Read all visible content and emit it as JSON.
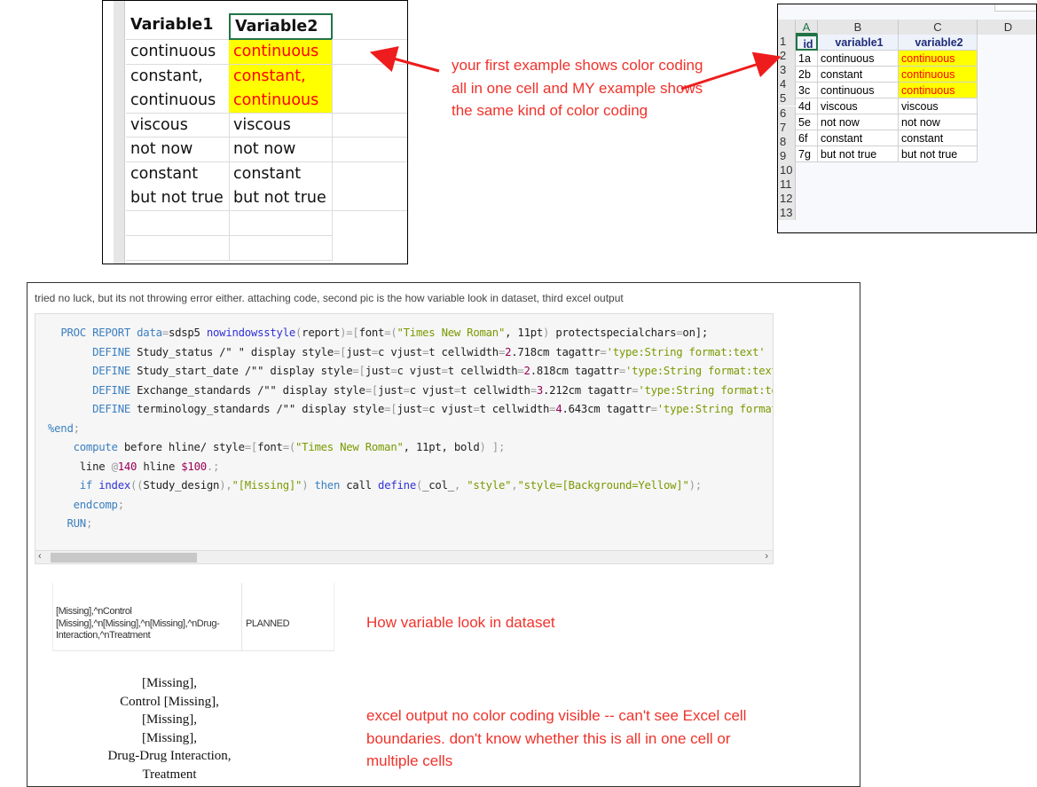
{
  "excel_example_1": {
    "headers": [
      "Variable1",
      "Variable2"
    ],
    "rows": [
      {
        "v1": [
          "continuous"
        ],
        "v2": [
          "continuous"
        ],
        "highlight": true
      },
      {
        "v1": [
          "constant,",
          "continuous"
        ],
        "v2": [
          "constant,",
          "continuous"
        ],
        "highlight": true
      },
      {
        "v1": [
          "viscous"
        ],
        "v2": [
          "viscous"
        ],
        "highlight": false
      },
      {
        "v1": [
          "not now"
        ],
        "v2": [
          "not now"
        ],
        "highlight": false
      },
      {
        "v1": [
          "constant",
          "but not true"
        ],
        "v2": [
          "constant",
          "but not true"
        ],
        "highlight": false
      }
    ]
  },
  "excel_example_2": {
    "col_headers": [
      "A",
      "B",
      "C",
      "D"
    ],
    "row_numbers": [
      "1",
      "2",
      "3",
      "4",
      "5",
      "6",
      "7",
      "8",
      "9",
      "10",
      "11",
      "12",
      "13"
    ],
    "headers": [
      "id",
      "variable1",
      "variable2"
    ],
    "rows": [
      [
        "1a",
        "continuous",
        "continuous"
      ],
      [
        "2b",
        "constant",
        "continuous"
      ],
      [
        "3c",
        "continuous",
        "continuous"
      ],
      [
        "4d",
        "viscous",
        "viscous"
      ],
      [
        "5e",
        "not now",
        "not now"
      ],
      [
        "6f",
        "constant",
        "constant"
      ],
      [
        "7g",
        "but not true",
        "but not true"
      ]
    ],
    "highlighted_rows": [
      0,
      1,
      2
    ]
  },
  "annotations": {
    "first": "your first example shows color coding all in one cell and MY example shows the same kind of color coding",
    "dataset": "How variable look in dataset",
    "excel": "excel output no color coding visible -- can't see Excel cell boundaries. don't know whether this is all in one cell or multiple cells"
  },
  "post": {
    "intro": "tried no luck, but its not throwing error either. attaching code, second pic is the how variable look in dataset, third excel output",
    "code_lines": [
      {
        "indent": "  ",
        "tokens": [
          [
            "PROC REPORT",
            "kw"
          ],
          [
            " ",
            "plain"
          ],
          [
            "data",
            "kw"
          ],
          [
            "=",
            "op"
          ],
          [
            "sdsp5 ",
            "plain"
          ],
          [
            "nowindowsstyle",
            "fn"
          ],
          [
            "(",
            "op"
          ],
          [
            "report",
            "plain"
          ],
          [
            ")=[",
            "op"
          ],
          [
            "font",
            "plain"
          ],
          [
            "=(",
            "op"
          ],
          [
            "\"Times New Roman\"",
            "str"
          ],
          [
            ", 11pt",
            "plain"
          ],
          [
            ")",
            "op"
          ],
          [
            " protectspecialchars",
            "plain"
          ],
          [
            "=",
            "op"
          ],
          [
            "on];",
            "plain"
          ]
        ]
      },
      {
        "indent": "       ",
        "tokens": [
          [
            "DEFINE",
            "kw"
          ],
          [
            " Study_status /\" \" display style",
            "plain"
          ],
          [
            "=[",
            "op"
          ],
          [
            "just",
            "plain"
          ],
          [
            "=",
            "op"
          ],
          [
            "c vjust",
            "plain"
          ],
          [
            "=",
            "op"
          ],
          [
            "t cellwidth",
            "plain"
          ],
          [
            "=",
            "op"
          ],
          [
            "2",
            "num"
          ],
          [
            ".718cm tagattr",
            "plain"
          ],
          [
            "=",
            "op"
          ],
          [
            "'type:String format:text'",
            "str"
          ]
        ]
      },
      {
        "indent": "       ",
        "tokens": [
          [
            "DEFINE",
            "kw"
          ],
          [
            " Study_start_date /\"\" display style",
            "plain"
          ],
          [
            "=[",
            "op"
          ],
          [
            "just",
            "plain"
          ],
          [
            "=",
            "op"
          ],
          [
            "c vjust",
            "plain"
          ],
          [
            "=",
            "op"
          ],
          [
            "t cellwidth",
            "plain"
          ],
          [
            "=",
            "op"
          ],
          [
            "2",
            "num"
          ],
          [
            ".818cm tagattr",
            "plain"
          ],
          [
            "=",
            "op"
          ],
          [
            "'type:String format:text'",
            "str"
          ]
        ]
      },
      {
        "indent": "       ",
        "tokens": [
          [
            "DEFINE",
            "kw"
          ],
          [
            " Exchange_standards /\"\" display style",
            "plain"
          ],
          [
            "=[",
            "op"
          ],
          [
            "just",
            "plain"
          ],
          [
            "=",
            "op"
          ],
          [
            "c vjust",
            "plain"
          ],
          [
            "=",
            "op"
          ],
          [
            "t cellwidth",
            "plain"
          ],
          [
            "=",
            "op"
          ],
          [
            "3",
            "num"
          ],
          [
            ".212cm tagattr",
            "plain"
          ],
          [
            "=",
            "op"
          ],
          [
            "'type:String format:text'",
            "str"
          ]
        ]
      },
      {
        "indent": "       ",
        "tokens": [
          [
            "DEFINE",
            "kw"
          ],
          [
            " terminology_standards /\"\" display style",
            "plain"
          ],
          [
            "=[",
            "op"
          ],
          [
            "just",
            "plain"
          ],
          [
            "=",
            "op"
          ],
          [
            "c vjust",
            "plain"
          ],
          [
            "=",
            "op"
          ],
          [
            "t cellwidth",
            "plain"
          ],
          [
            "=",
            "op"
          ],
          [
            "4",
            "num"
          ],
          [
            ".643cm tagattr",
            "plain"
          ],
          [
            "=",
            "op"
          ],
          [
            "'type:String format:text'",
            "str"
          ]
        ]
      },
      {
        "indent": "",
        "tokens": [
          [
            "%end",
            "kw"
          ],
          [
            ";",
            "op"
          ]
        ]
      },
      {
        "indent": "    ",
        "tokens": [
          [
            "compute",
            "kw"
          ],
          [
            " before hline/ style",
            "plain"
          ],
          [
            "=[",
            "op"
          ],
          [
            "font",
            "plain"
          ],
          [
            "=(",
            "op"
          ],
          [
            "\"Times New Roman\"",
            "str"
          ],
          [
            ", 11pt, bold",
            "plain"
          ],
          [
            ") ];",
            "op"
          ]
        ]
      },
      {
        "indent": "     ",
        "tokens": [
          [
            "line ",
            "plain"
          ],
          [
            "@",
            "op"
          ],
          [
            "140",
            "num"
          ],
          [
            " hline ",
            "plain"
          ],
          [
            "$100",
            "num"
          ],
          [
            ".;",
            "op"
          ]
        ]
      },
      {
        "indent": "     ",
        "tokens": [
          [
            "if",
            "kw"
          ],
          [
            " ",
            "plain"
          ],
          [
            "index",
            "fn"
          ],
          [
            "((",
            "op"
          ],
          [
            "Study_design",
            "plain"
          ],
          [
            "),",
            "op"
          ],
          [
            "\"[Missing]\"",
            "str"
          ],
          [
            ") ",
            "op"
          ],
          [
            "then",
            "kw"
          ],
          [
            " call ",
            "plain"
          ],
          [
            "define",
            "fn"
          ],
          [
            "(",
            "op"
          ],
          [
            "_col_",
            "plain"
          ],
          [
            ", ",
            "op"
          ],
          [
            "\"style\"",
            "str"
          ],
          [
            ",",
            "op"
          ],
          [
            "\"style=[Background=Yellow]\"",
            "str"
          ],
          [
            ");",
            "op"
          ]
        ]
      },
      {
        "indent": "    ",
        "tokens": [
          [
            "endcomp",
            "kw"
          ],
          [
            ";",
            "op"
          ]
        ]
      },
      {
        "indent": "   ",
        "tokens": [
          [
            "RUN",
            "kw"
          ],
          [
            ";",
            "op"
          ]
        ]
      }
    ],
    "dataset_cells": [
      "[Missing],^nControl [Missing],^n[Missing],^n[Missing],^nDrug-Interaction,^nTreatment",
      "PLANNED"
    ],
    "excel_output_lines": [
      "[Missing],",
      "Control [Missing],",
      "[Missing],",
      "[Missing],",
      "Drug-Drug Interaction,",
      "Treatment"
    ]
  },
  "colors": {
    "highlight": "#ffff00",
    "highlight_text": "#ff0000",
    "annotation": "#f0322b",
    "header_text": "#1f2d7a"
  }
}
